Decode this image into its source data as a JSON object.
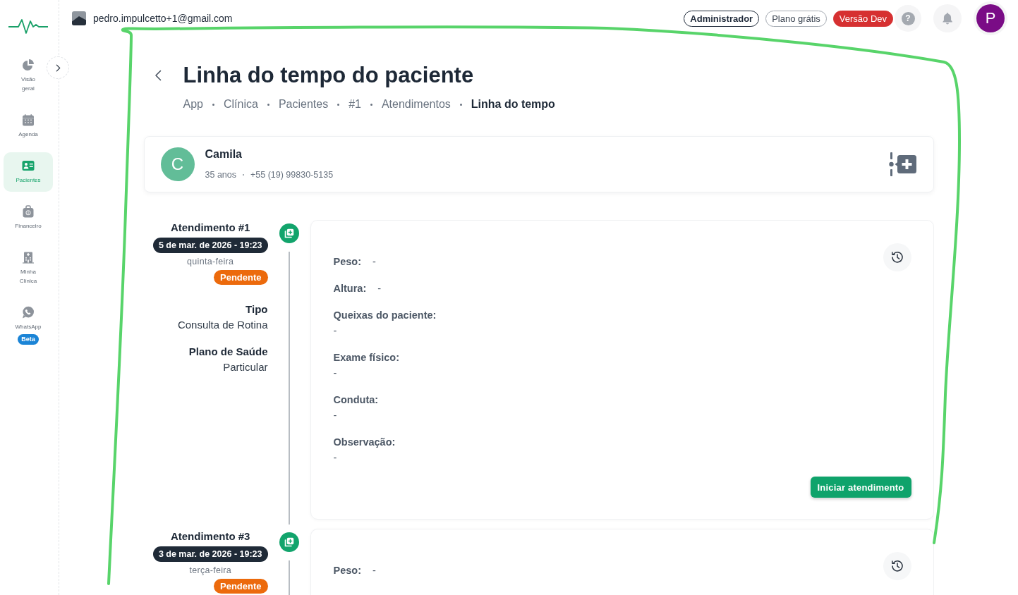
{
  "sidebar": {
    "items": [
      {
        "label": "Visão geral",
        "selected": false
      },
      {
        "label": "Agenda",
        "selected": false
      },
      {
        "label": "Pacientes",
        "selected": true
      },
      {
        "label": "Financeiro",
        "selected": false
      },
      {
        "label": "Minha Clínica",
        "selected": false
      },
      {
        "label": "WhatsApp",
        "selected": false,
        "badge": "Beta"
      }
    ]
  },
  "topbar": {
    "email": "pedro.impulcetto+1@gmail.com",
    "badges": [
      {
        "label": "Administrador",
        "kind": "role"
      },
      {
        "label": "Plano grátis",
        "kind": "plan"
      },
      {
        "label": "Versão Dev",
        "kind": "env"
      }
    ],
    "help": "?",
    "avatar": "P"
  },
  "page": {
    "title": "Linha do tempo do paciente",
    "breadcrumb": [
      {
        "label": "App",
        "current": false
      },
      {
        "label": "Clínica",
        "current": false
      },
      {
        "label": "Pacientes",
        "current": false
      },
      {
        "label": "#1",
        "current": false
      },
      {
        "label": "Atendimentos",
        "current": false
      },
      {
        "label": "Linha do tempo",
        "current": true
      }
    ]
  },
  "patient": {
    "initial": "C",
    "name": "Camila",
    "age": "35 anos",
    "phone": "+55 (19) 99830-5135"
  },
  "timeline": [
    {
      "title": "Atendimento #1",
      "date": "5 de mar. de 2026 - 19:23",
      "weekday": "quinta-feira",
      "status": {
        "label": "Pendente",
        "kind": "pending"
      },
      "details": [
        {
          "label": "Tipo",
          "value": "Consulta de Rotina"
        },
        {
          "label": "Plano de Saúde",
          "value": "Particular"
        }
      ],
      "fields": [
        {
          "label": "Peso:",
          "value": "-",
          "kind": "inline"
        },
        {
          "label": "Altura:",
          "value": "-",
          "kind": "inline"
        },
        {
          "label": "Queixas do paciente:",
          "value": "-",
          "kind": "block"
        },
        {
          "label": "Exame físico:",
          "value": "-",
          "kind": "block"
        },
        {
          "label": "Conduta:",
          "value": "-",
          "kind": "block"
        },
        {
          "label": "Observação:",
          "value": "-",
          "kind": "block"
        }
      ],
      "action": "Iniciar atendimento"
    },
    {
      "title": "Atendimento #3",
      "date": "3 de mar. de 2026 - 19:23",
      "weekday": "terça-feira",
      "status": {
        "label": "Pendente",
        "kind": "pending"
      },
      "fields": [
        {
          "label": "Peso:",
          "value": "-",
          "kind": "inline"
        }
      ]
    }
  ]
}
